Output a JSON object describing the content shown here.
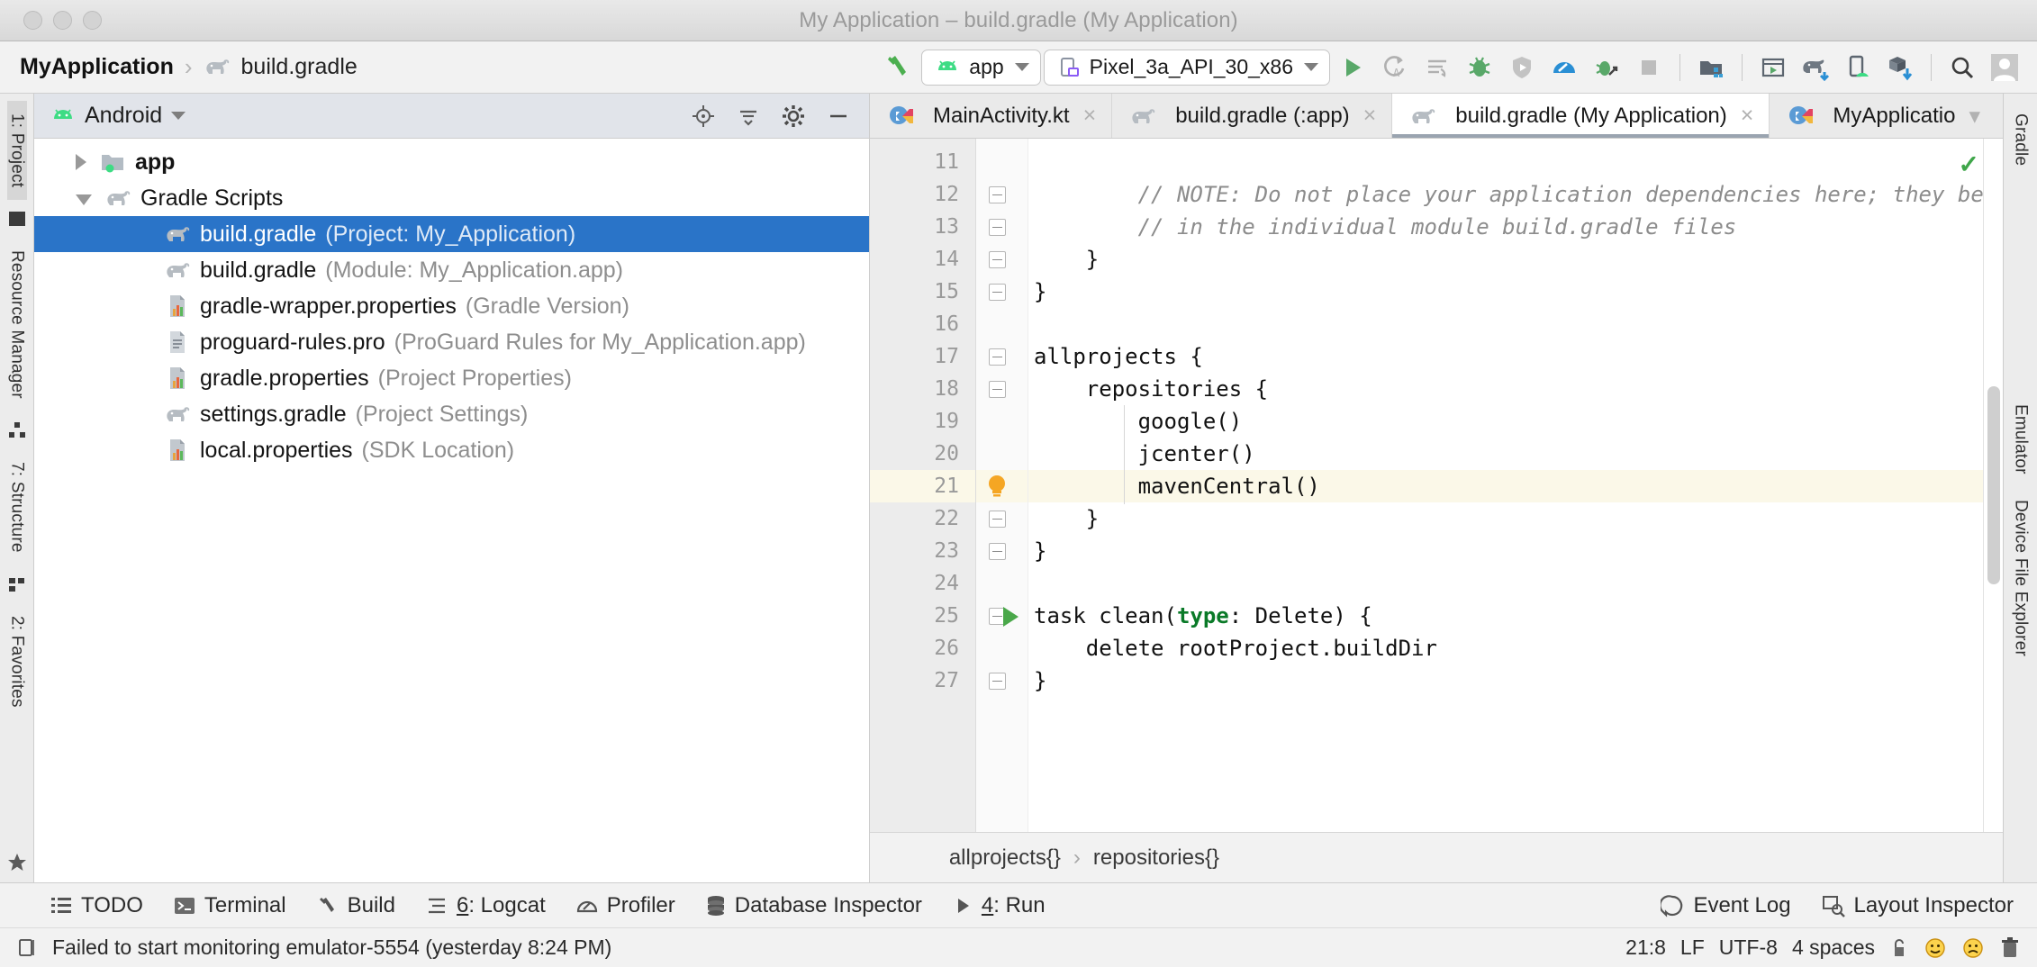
{
  "window": {
    "title": "My Application – build.gradle (My Application)"
  },
  "breadcrumb": {
    "project": "MyApplication",
    "separator": "›",
    "file": "build.gradle"
  },
  "toolbar": {
    "module_selector": "app",
    "device_selector": "Pixel_3a_API_30_x86",
    "buttons": [
      {
        "name": "make-project-button",
        "icon": "hammer-icon"
      },
      {
        "name": "run-button",
        "icon": "play-icon"
      },
      {
        "name": "apply-changes-button",
        "icon": "apply-changes-icon"
      },
      {
        "name": "apply-code-changes-button",
        "icon": "apply-code-changes-icon"
      },
      {
        "name": "debug-button",
        "icon": "bug-icon"
      },
      {
        "name": "run-coverage-button",
        "icon": "shield-run-icon"
      },
      {
        "name": "profiler-button",
        "icon": "gauge-icon"
      },
      {
        "name": "attach-debugger-button",
        "icon": "attach-debug-icon"
      },
      {
        "name": "stop-button",
        "icon": "stop-square-icon"
      },
      {
        "name": "avd-manager-button",
        "icon": "avd-folder-icon"
      },
      {
        "name": "device-manager-button",
        "icon": "device-window-icon"
      },
      {
        "name": "gradle-sync-button",
        "icon": "elephant-sync-icon"
      },
      {
        "name": "device-file-button",
        "icon": "phone-android-icon"
      },
      {
        "name": "sdk-manager-button",
        "icon": "sdk-box-icon"
      },
      {
        "name": "search-everywhere-button",
        "icon": "search-icon"
      },
      {
        "name": "user-account-button",
        "icon": "avatar-icon"
      }
    ]
  },
  "left_rail": {
    "tabs": [
      "1: Project",
      "Resource Manager",
      "7: Structure",
      "2: Favorites"
    ]
  },
  "right_rail": {
    "tabs": [
      "Gradle",
      "Emulator",
      "Device File Explorer"
    ]
  },
  "project_panel": {
    "header_title": "Android",
    "tree": [
      {
        "name": "app",
        "sub": "",
        "icon": "folder-module-icon",
        "depth": 0,
        "expanded": false,
        "bold": true,
        "selected": false
      },
      {
        "name": "Gradle Scripts",
        "sub": "",
        "icon": "gradle-elephant-icon",
        "depth": 0,
        "expanded": true,
        "bold": false,
        "selected": false
      },
      {
        "name": "build.gradle",
        "sub": "(Project: My_Application)",
        "icon": "gradle-elephant-icon",
        "depth": 1,
        "expanded": null,
        "bold": false,
        "selected": true
      },
      {
        "name": "build.gradle",
        "sub": "(Module: My_Application.app)",
        "icon": "gradle-elephant-icon",
        "depth": 1,
        "expanded": null,
        "bold": false,
        "selected": false
      },
      {
        "name": "gradle-wrapper.properties",
        "sub": "(Gradle Version)",
        "icon": "properties-file-icon",
        "depth": 1,
        "expanded": null,
        "bold": false,
        "selected": false
      },
      {
        "name": "proguard-rules.pro",
        "sub": "(ProGuard Rules for My_Application.app)",
        "icon": "text-file-icon",
        "depth": 1,
        "expanded": null,
        "bold": false,
        "selected": false
      },
      {
        "name": "gradle.properties",
        "sub": "(Project Properties)",
        "icon": "properties-file-icon",
        "depth": 1,
        "expanded": null,
        "bold": false,
        "selected": false
      },
      {
        "name": "settings.gradle",
        "sub": "(Project Settings)",
        "icon": "gradle-elephant-icon",
        "depth": 1,
        "expanded": null,
        "bold": false,
        "selected": false
      },
      {
        "name": "local.properties",
        "sub": "(SDK Location)",
        "icon": "properties-file-icon",
        "depth": 1,
        "expanded": null,
        "bold": false,
        "selected": false
      }
    ]
  },
  "editor": {
    "tabs": [
      {
        "label": "MainActivity.kt",
        "icon": "kotlin-icon",
        "active": false,
        "closable": true
      },
      {
        "label": "build.gradle (:app)",
        "icon": "gradle-elephant-icon",
        "active": false,
        "closable": true
      },
      {
        "label": "build.gradle (My Application)",
        "icon": "gradle-elephant-icon",
        "active": true,
        "closable": true
      },
      {
        "label": "MyApplicatio",
        "icon": "kotlin-icon",
        "active": false,
        "closable": false
      }
    ],
    "lines": [
      {
        "num": "11",
        "text": "",
        "highlight": false,
        "fold": "",
        "bulb": false,
        "run": false
      },
      {
        "num": "12",
        "text": "        // NOTE: Do not place your application dependencies here; they belong",
        "highlight": false,
        "fold": "mid",
        "bulb": false,
        "run": false,
        "style": "comment"
      },
      {
        "num": "13",
        "text": "        // in the individual module build.gradle files",
        "highlight": false,
        "fold": "end",
        "bulb": false,
        "run": false,
        "style": "comment"
      },
      {
        "num": "14",
        "text": "    }",
        "highlight": false,
        "fold": "end",
        "bulb": false,
        "run": false
      },
      {
        "num": "15",
        "text": "}",
        "highlight": false,
        "fold": "end",
        "bulb": false,
        "run": false
      },
      {
        "num": "16",
        "text": "",
        "highlight": false,
        "fold": "",
        "bulb": false,
        "run": false
      },
      {
        "num": "17",
        "text": "allprojects {",
        "highlight": false,
        "fold": "start",
        "bulb": false,
        "run": false
      },
      {
        "num": "18",
        "text": "    repositories {",
        "highlight": false,
        "fold": "start",
        "bulb": false,
        "run": false
      },
      {
        "num": "19",
        "text": "        google()",
        "highlight": false,
        "fold": "",
        "bulb": false,
        "run": false
      },
      {
        "num": "20",
        "text": "        jcenter()",
        "highlight": false,
        "fold": "",
        "bulb": false,
        "run": false
      },
      {
        "num": "21",
        "text": "        mavenCentral()",
        "highlight": true,
        "fold": "",
        "bulb": true,
        "run": false
      },
      {
        "num": "22",
        "text": "    }",
        "highlight": false,
        "fold": "end",
        "bulb": false,
        "run": false
      },
      {
        "num": "23",
        "text": "}",
        "highlight": false,
        "fold": "end",
        "bulb": false,
        "run": false
      },
      {
        "num": "24",
        "text": "",
        "highlight": false,
        "fold": "",
        "bulb": false,
        "run": false
      },
      {
        "num": "25",
        "text": "task clean(type: Delete) {",
        "highlight": false,
        "fold": "start",
        "bulb": false,
        "run": true,
        "style": "keyword-type"
      },
      {
        "num": "26",
        "text": "    delete rootProject.buildDir",
        "highlight": false,
        "fold": "",
        "bulb": false,
        "run": false
      },
      {
        "num": "27",
        "text": "}",
        "highlight": false,
        "fold": "end",
        "bulb": false,
        "run": false
      }
    ],
    "inspection_status": "✓",
    "breadcrumb_path": [
      "allprojects{}",
      "repositories{}"
    ],
    "breadcrumb_sep": "›"
  },
  "bottom_bar": {
    "left_items": [
      {
        "label": "TODO",
        "icon": "todo-list-icon",
        "mnemonic": ""
      },
      {
        "label": "Terminal",
        "icon": "terminal-icon",
        "mnemonic": ""
      },
      {
        "label": "Build",
        "icon": "hammer-icon",
        "mnemonic": ""
      },
      {
        "label": "Logcat",
        "icon": "logcat-icon",
        "mnemonic": "6"
      },
      {
        "label": "Profiler",
        "icon": "gauge-icon",
        "mnemonic": ""
      },
      {
        "label": "Database Inspector",
        "icon": "database-icon",
        "mnemonic": ""
      },
      {
        "label": "Run",
        "icon": "play-icon",
        "mnemonic": "4"
      }
    ],
    "right_items": [
      {
        "label": "Event Log",
        "icon": "event-log-icon"
      },
      {
        "label": "Layout Inspector",
        "icon": "layout-inspector-icon"
      }
    ]
  },
  "status_bar": {
    "message": "Failed to start monitoring emulator-5554 (yesterday 8:24 PM)",
    "caret_position": "21:8",
    "line_separator": "LF",
    "encoding": "UTF-8",
    "indent": "4 spaces",
    "icons": [
      "lock-icon",
      "happy-face-icon",
      "sad-face-icon",
      "trash-icon"
    ]
  },
  "colors": {
    "selection_blue": "#2a74c8",
    "android_green": "#3ddc84",
    "highlight_yellow": "#fbf8e8",
    "keyword_green": "#0a7a28",
    "comment_gray": "#8c8c8c",
    "titlebar_gray": "#9a9a9a"
  }
}
